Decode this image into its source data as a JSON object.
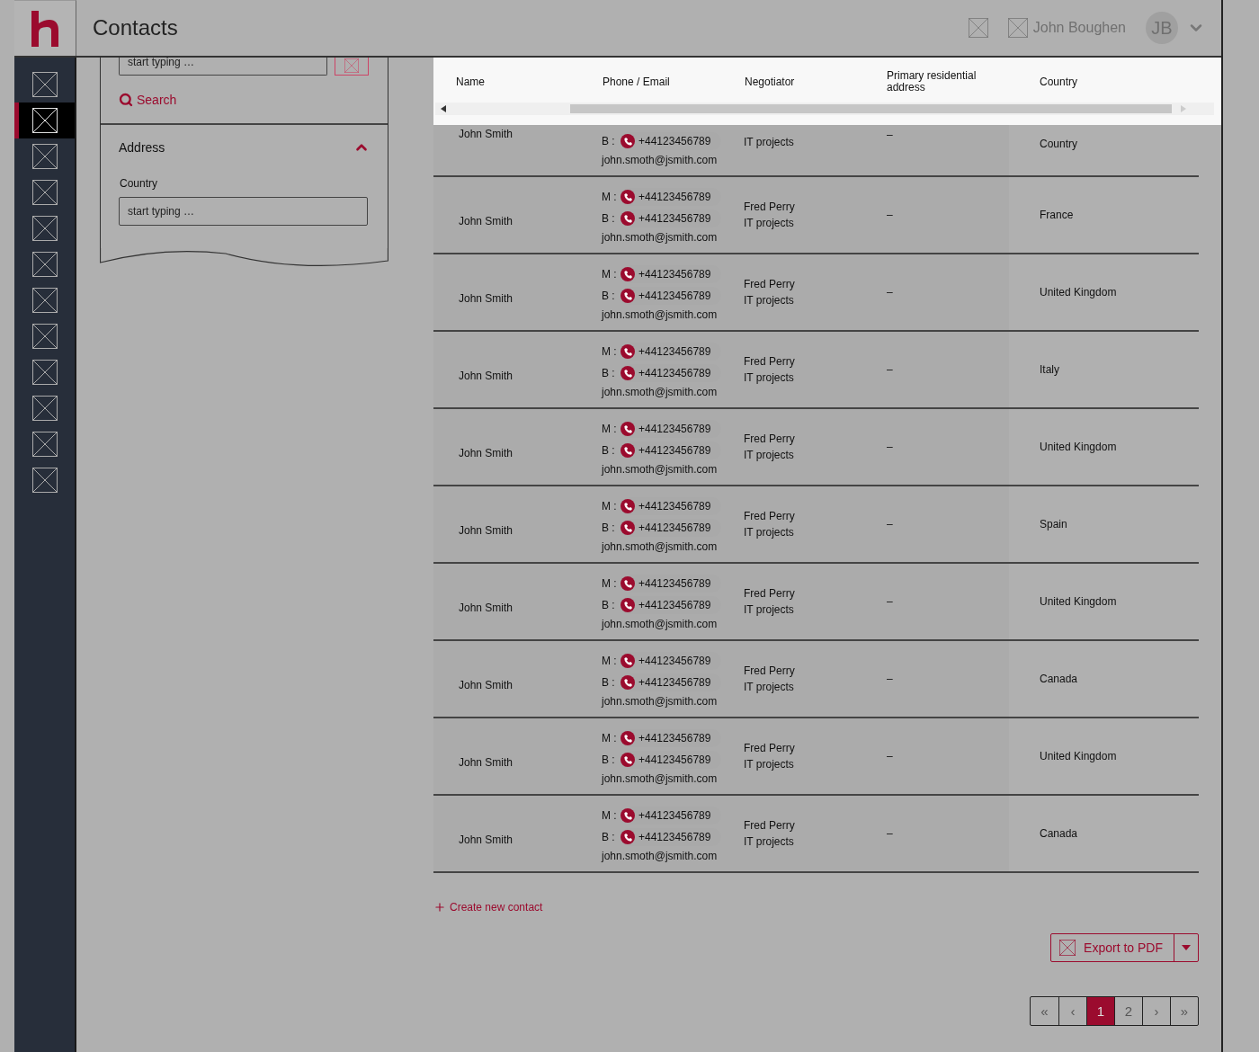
{
  "app": {
    "title": "Contacts"
  },
  "header": {
    "user_name": "John Boughen",
    "avatar_initials": "JB"
  },
  "sidebar": {
    "items": [
      {
        "selected": false
      },
      {
        "selected": true
      },
      {
        "selected": false
      },
      {
        "selected": false
      },
      {
        "selected": false
      },
      {
        "selected": false
      },
      {
        "selected": false
      },
      {
        "selected": false
      },
      {
        "selected": false
      },
      {
        "selected": false
      },
      {
        "selected": false
      },
      {
        "selected": false
      }
    ]
  },
  "filters": {
    "top_field": {
      "placeholder": "start typing …"
    },
    "search_link": "Search",
    "section": {
      "title": "Address",
      "expanded": true,
      "field_label": "Country",
      "field": {
        "placeholder": "start typing …"
      }
    }
  },
  "table": {
    "columns": [
      "Name",
      "Phone / Email",
      "Negotiator",
      "Primary residential address",
      "Country"
    ],
    "rows": [
      {
        "kind": "partial",
        "name": "John Smith",
        "phones": [
          {
            "label": "B :",
            "number": "+44123456789"
          }
        ],
        "email": "john.smoth@jsmith.com",
        "team": "IT projects",
        "address": "–",
        "country": "Country"
      },
      {
        "kind": "full",
        "name": "John Smith",
        "phones": [
          {
            "label": "M :",
            "number": "+44123456789"
          },
          {
            "label": "B :",
            "number": "+44123456789"
          }
        ],
        "email": "john.smoth@jsmith.com",
        "negotiator": "Fred Perry",
        "team": "IT projects",
        "address": "–",
        "country": "France"
      },
      {
        "kind": "full",
        "name": "John Smith",
        "phones": [
          {
            "label": "M :",
            "number": "+44123456789"
          },
          {
            "label": "B :",
            "number": "+44123456789"
          }
        ],
        "email": "john.smoth@jsmith.com",
        "negotiator": "Fred Perry",
        "team": "IT projects",
        "address": "–",
        "country": "United Kingdom"
      },
      {
        "kind": "full",
        "name": "John Smith",
        "phones": [
          {
            "label": "M :",
            "number": "+44123456789"
          },
          {
            "label": "B :",
            "number": "+44123456789"
          }
        ],
        "email": "john.smoth@jsmith.com",
        "negotiator": "Fred Perry",
        "team": "IT projects",
        "address": "–",
        "country": "Italy"
      },
      {
        "kind": "full",
        "name": "John Smith",
        "phones": [
          {
            "label": "M :",
            "number": "+44123456789"
          },
          {
            "label": "B :",
            "number": "+44123456789"
          }
        ],
        "email": "john.smoth@jsmith.com",
        "negotiator": "Fred Perry",
        "team": "IT projects",
        "address": "–",
        "country": "United Kingdom"
      },
      {
        "kind": "full",
        "name": "John Smith",
        "phones": [
          {
            "label": "M :",
            "number": "+44123456789"
          },
          {
            "label": "B :",
            "number": "+44123456789"
          }
        ],
        "email": "john.smoth@jsmith.com",
        "negotiator": "Fred Perry",
        "team": "IT projects",
        "address": "–",
        "country": "Spain"
      },
      {
        "kind": "full",
        "name": "John Smith",
        "phones": [
          {
            "label": "M :",
            "number": "+44123456789"
          },
          {
            "label": "B :",
            "number": "+44123456789"
          }
        ],
        "email": "john.smoth@jsmith.com",
        "negotiator": "Fred Perry",
        "team": "IT projects",
        "address": "–",
        "country": "United Kingdom"
      },
      {
        "kind": "full",
        "name": "John Smith",
        "phones": [
          {
            "label": "M :",
            "number": "+44123456789"
          },
          {
            "label": "B :",
            "number": "+44123456789"
          }
        ],
        "email": "john.smoth@jsmith.com",
        "negotiator": "Fred Perry",
        "team": "IT projects",
        "address": "–",
        "country": "Canada"
      },
      {
        "kind": "full",
        "name": "John Smith",
        "phones": [
          {
            "label": "M :",
            "number": "+44123456789"
          },
          {
            "label": "B :",
            "number": "+44123456789"
          }
        ],
        "email": "john.smoth@jsmith.com",
        "negotiator": "Fred Perry",
        "team": "IT projects",
        "address": "–",
        "country": "United Kingdom"
      },
      {
        "kind": "full",
        "name": "John Smith",
        "phones": [
          {
            "label": "M :",
            "number": "+44123456789"
          },
          {
            "label": "B :",
            "number": "+44123456789"
          }
        ],
        "email": "john.smoth@jsmith.com",
        "negotiator": "Fred Perry",
        "team": "IT projects",
        "address": "–",
        "country": "Canada"
      }
    ]
  },
  "create_link": "Create new contact",
  "export_button": "Export to PDF",
  "pagination": [
    {
      "label": "«",
      "selected": false
    },
    {
      "label": "‹",
      "selected": false
    },
    {
      "label": "1",
      "selected": true
    },
    {
      "label": "2",
      "selected": false
    },
    {
      "label": "›",
      "selected": false
    },
    {
      "label": "»",
      "selected": false
    }
  ]
}
